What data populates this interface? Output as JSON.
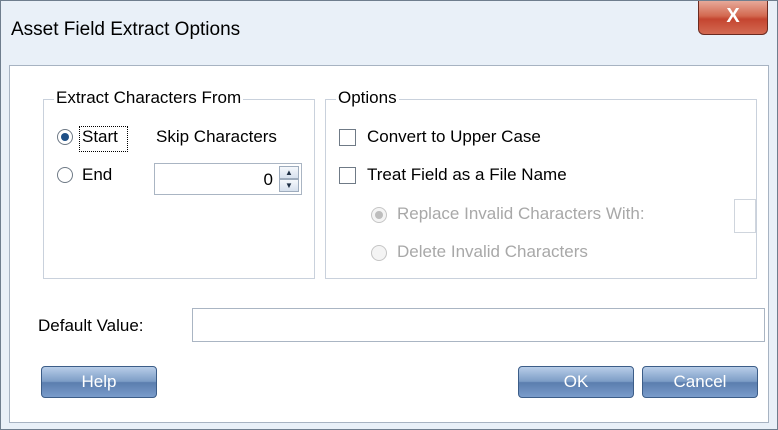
{
  "window": {
    "title": "Asset Field Extract Options",
    "close_label": "X"
  },
  "extract_group": {
    "legend": "Extract Characters From",
    "start_label": "Start",
    "end_label": "End",
    "skip_label": "Skip Characters",
    "skip_value": "0",
    "selected": "Start"
  },
  "options_group": {
    "legend": "Options",
    "convert_upper_label": "Convert to Upper Case",
    "convert_upper_checked": false,
    "treat_file_label": "Treat Field as a File Name",
    "treat_file_checked": false,
    "replace_label": "Replace Invalid Characters With:",
    "replace_value": "",
    "delete_label": "Delete Invalid Characters",
    "selected": "Replace Invalid Characters With:"
  },
  "default_value": {
    "label": "Default Value:",
    "value": ""
  },
  "buttons": {
    "help": "Help",
    "ok": "OK",
    "cancel": "Cancel"
  },
  "colors": {
    "button": "#6e90bf",
    "titlebar": "#e9f0f8",
    "close": "#c9503a"
  }
}
